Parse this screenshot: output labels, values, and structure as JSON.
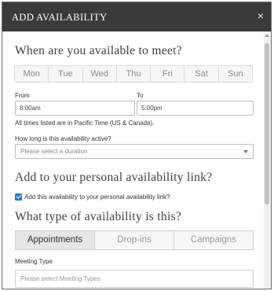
{
  "dialog": {
    "title": "ADD AVAILABILITY",
    "close_label": "×"
  },
  "meet_section": {
    "heading": "When are you available to meet?",
    "days": [
      "Mon",
      "Tue",
      "Wed",
      "Thu",
      "Fri",
      "Sat",
      "Sun"
    ]
  },
  "time": {
    "from_label": "From",
    "from_value": "8:00am",
    "to_label": "To",
    "to_value": "5:00pm",
    "timezone_note": "All times listed are in Pacific Time (US & Canada)."
  },
  "duration": {
    "label": "How long is this availability active?",
    "placeholder": "Please select a duration"
  },
  "personal_link": {
    "heading": "Add to your personal availability link?",
    "checkbox_label": "Add this availability to your personal availability link?",
    "checked": true
  },
  "type_section": {
    "heading": "What type of availability is this?",
    "tabs": [
      "Appointments",
      "Drop-ins",
      "Campaigns"
    ],
    "active_tab": "Appointments"
  },
  "meeting_type": {
    "label": "Meeting Type",
    "placeholder": "Please select Meeting Types"
  },
  "colors": {
    "header_bg": "#3a3a3a",
    "accent": "#2b78c4"
  }
}
